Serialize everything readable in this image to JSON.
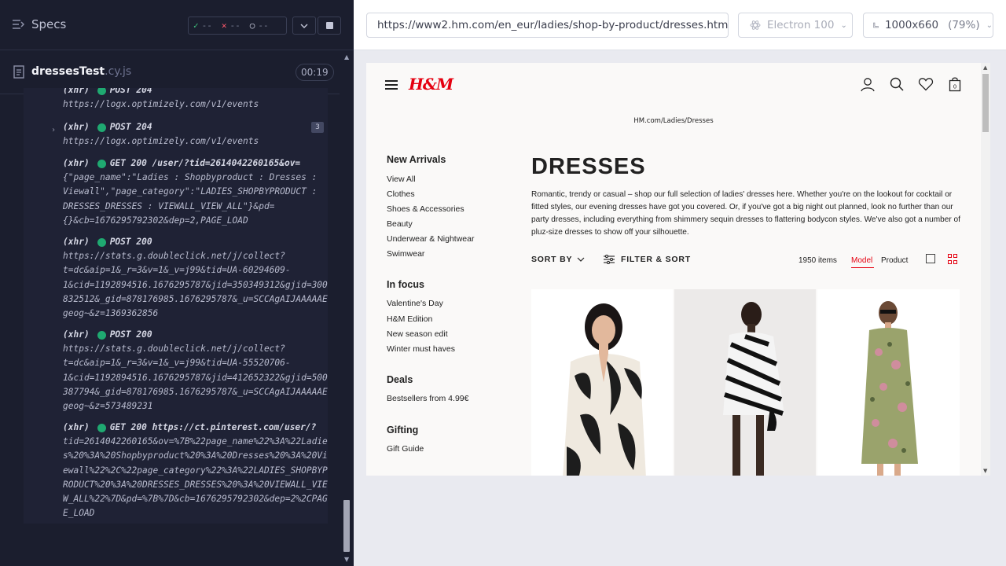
{
  "reporter": {
    "specs_label": "Specs",
    "stats": {
      "passed": "--",
      "failed": "--",
      "pending": "--"
    },
    "spec_file": {
      "name": "dressesTest",
      "ext": ".cy.js"
    },
    "duration": "00:19",
    "log": [
      {
        "type": "(xhr)",
        "method": "POST 204",
        "lines": [
          "https://logx.optimizely.com/v1/events"
        ]
      },
      {
        "type": "(xhr)",
        "method": "POST 204",
        "badge": "3",
        "lines": [
          "https://logx.optimizely.com/v1/events"
        ]
      },
      {
        "type": "(xhr)",
        "method": "GET 200 /user/?tid=2614042260165&ov=",
        "lines": [
          "{\"page_name\":\"Ladies : Shopbyproduct : Dresses :",
          "Viewall\",\"page_category\":\"LADIES_SHOPBYPRODUCT :",
          "DRESSES_DRESSES : VIEWALL_VIEW_ALL\"}&pd=",
          "{}&cb=1676295792302&dep=2,PAGE_LOAD"
        ]
      },
      {
        "type": "(xhr)",
        "method": "POST 200",
        "lines": [
          "https://stats.g.doubleclick.net/j/collect?",
          "t=dc&aip=1&_r=3&v=1&_v=j99&tid=UA-60294609-",
          "1&cid=1192894516.1676295787&jid=350349312&gjid=300",
          "832512&_gid=878176985.1676295787&_u=SCCAgAIJAAAAAE",
          "geog~&z=1369362856"
        ]
      },
      {
        "type": "(xhr)",
        "method": "POST 200",
        "lines": [
          "https://stats.g.doubleclick.net/j/collect?",
          "t=dc&aip=1&_r=3&v=1&_v=j99&tid=UA-55520706-",
          "1&cid=1192894516.1676295787&jid=412652322&gjid=500",
          "387794&_gid=878176985.1676295787&_u=SCCAgAIJAAAAAE",
          "geog~&z=573489231"
        ]
      },
      {
        "type": "(xhr)",
        "method": "GET 200 https://ct.pinterest.com/user/?",
        "lines": [
          "tid=2614042260165&ov=%7B%22page_name%22%3A%22Ladie",
          "s%20%3A%20Shopbyproduct%20%3A%20Dresses%20%3A%20Vi",
          "ewall%22%2C%22page_category%22%3A%22LADIES_SHOPBYP",
          "RODUCT%20%3A%20DRESSES_DRESSES%20%3A%20VIEWALL_VIE",
          "W_ALL%22%7D&pd=%7B%7D&cb=1676295792302&dep=2%2CPAG",
          "E_LOAD"
        ]
      }
    ]
  },
  "aut": {
    "url": "https://www2.hm.com/en_eur/ladies/shop-by-product/dresses.html",
    "browser": "Electron 100",
    "viewport": "1000x660",
    "zoom": "(79%)"
  },
  "hm": {
    "logo": "H&M",
    "breadcrumb": "HM.com/Ladies/Dresses",
    "nav": {
      "new_arrivals": {
        "title": "New Arrivals",
        "items": [
          "View All",
          "Clothes",
          "Shoes & Accessories",
          "Beauty",
          "Underwear & Nightwear",
          "Swimwear"
        ]
      },
      "in_focus": {
        "title": "In focus",
        "items": [
          "Valentine's Day",
          "H&M Edition",
          "New season edit",
          "Winter must haves"
        ]
      },
      "deals": {
        "title": "Deals",
        "items": [
          "Bestsellers from 4.99€"
        ]
      },
      "gifting": {
        "title": "Gifting",
        "items": [
          "Gift Guide"
        ]
      }
    },
    "title": "DRESSES",
    "intro": "Romantic, trendy or casual – shop our full selection of ladies' dresses here. Whether you're on the lookout for cocktail or fitted styles, our evening dresses have got you covered. Or, if you've got a big night out planned, look no further than our party dresses, including everything from shimmery sequin dresses to flattering bodycon styles. We've also got a number of pluz-size dresses to show off your silhouette.",
    "sort_label": "SORT BY",
    "filter_label": "FILTER & SORT",
    "items_count": "1950 items",
    "view_model": "Model",
    "view_product": "Product"
  }
}
